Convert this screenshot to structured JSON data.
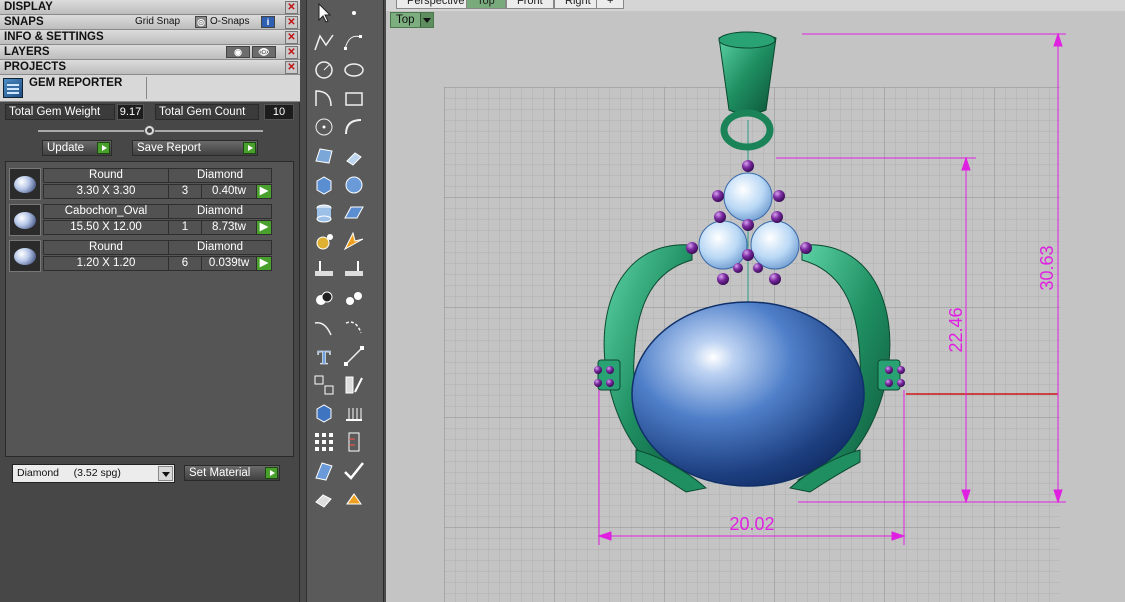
{
  "panels": {
    "display": "DISPLAY",
    "snaps": "SNAPS",
    "grid_snap": "Grid Snap",
    "o_snaps": "O-Snaps",
    "info_settings": "INFO & SETTINGS",
    "layers": "LAYERS",
    "projects": "PROJECTS",
    "gem_reporter": "GEM REPORTER"
  },
  "totals": {
    "weight_label": "Total Gem Weight",
    "weight_value": "9.17",
    "count_label": "Total Gem Count",
    "count_value": "10"
  },
  "buttons": {
    "update": "Update",
    "save_report": "Save Report",
    "set_material": "Set Material"
  },
  "gems": [
    {
      "shape": "Round",
      "type": "Diamond",
      "size": "3.30 X 3.30",
      "count": "3",
      "weight": "0.40tw"
    },
    {
      "shape": "Cabochon_Oval",
      "type": "Diamond",
      "size": "15.50 X 12.00",
      "count": "1",
      "weight": "8.73tw"
    },
    {
      "shape": "Round",
      "type": "Diamond",
      "size": "1.20 X 1.20",
      "count": "6",
      "weight": "0.039tw"
    }
  ],
  "material": {
    "selected": "Diamond     (3.52 spg)"
  },
  "viewport": {
    "tabs": [
      "Perspective",
      "Top",
      "Front",
      "Right",
      "+"
    ],
    "active_tab": "Top",
    "view_label": "Top",
    "dimensions": {
      "width": "20.02",
      "height_inner": "22.46",
      "height_outer": "30.63"
    }
  },
  "colors": {
    "grid_background": "#c4c4c4",
    "metal": "#1f8f62",
    "cabochon": "#3f6fb8",
    "small_gems": "#5b1a7a",
    "dimension_lines": "#e020e0",
    "view_label": "#7cae80"
  },
  "toolbar_icons": [
    "select-arrow-icon",
    "point-icon",
    "polyline-icon",
    "curve-points-icon",
    "circle-icon",
    "ellipse-icon",
    "arc-icon",
    "rectangle-icon",
    "circle-center-icon",
    "curve-icon",
    "surface-icon",
    "extrude-icon",
    "box-icon",
    "sphere-icon",
    "cylinder-icon",
    "plane-icon",
    "gem-settings-icon",
    "gem-star-icon",
    "split-icon",
    "trim-icon",
    "boolean-icon",
    "mirror-icon",
    "offset-curve-icon",
    "blend-icon",
    "text-icon",
    "transform-icon",
    "array-icon",
    "scale-icon",
    "solid-box-icon",
    "prongs-icon",
    "grid-array-icon",
    "measure-icon",
    "analyze-icon",
    "check-icon",
    "render-icon",
    "material-icon"
  ]
}
